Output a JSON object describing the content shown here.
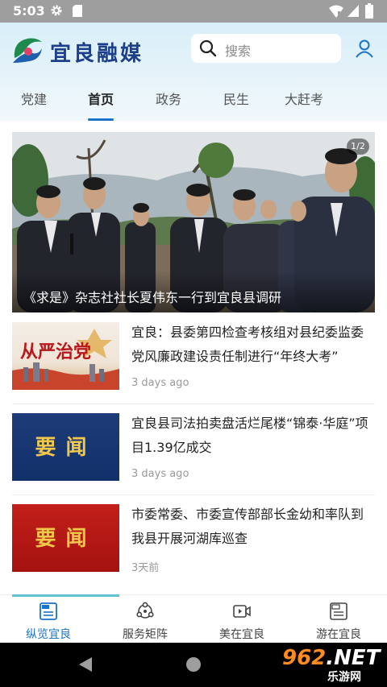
{
  "status": {
    "time": "5:03"
  },
  "header": {
    "logo_text": "宜良融媒",
    "search_placeholder": "搜索"
  },
  "tabs": [
    {
      "label": "党建"
    },
    {
      "label": "首页"
    },
    {
      "label": "政务"
    },
    {
      "label": "民生"
    },
    {
      "label": "大赶考"
    }
  ],
  "hero": {
    "counter": "1/2",
    "caption": "《求是》杂志社社长夏伟东一行到宜良县调研"
  },
  "news": [
    {
      "title": "宜良：县委第四检查考核组对县纪委监委党风廉政建设责任制进行“年终大考”",
      "time": "3 days ago",
      "thumb_text": "从严治党"
    },
    {
      "title": "宜良县司法拍卖盘活烂尾楼“锦泰·华庭”项目1.39亿成交",
      "time": "3 days ago",
      "thumb_text": "要闻"
    },
    {
      "title": "市委常委、市委宣传部部长金幼和率队到我县开展河湖库巡查",
      "time": "3天前",
      "thumb_text": "要闻"
    }
  ],
  "bottom_nav": [
    {
      "label": "纵览宜良",
      "icon": "newspaper-icon"
    },
    {
      "label": "服务矩阵",
      "icon": "network-icon"
    },
    {
      "label": "美在宜良",
      "icon": "video-icon"
    },
    {
      "label": "游在宜良",
      "icon": "newspaper-icon"
    }
  ],
  "watermark": {
    "number": "962",
    "dot_net": ".NET",
    "sub": "乐游网"
  },
  "colors": {
    "accent": "#1a73c9",
    "logo_text": "#1d3f8a",
    "nav_indicator": "#61c2d2"
  }
}
